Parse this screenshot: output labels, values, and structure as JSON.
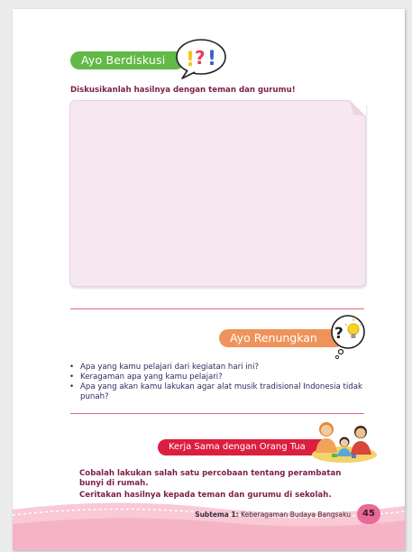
{
  "discussion": {
    "title": "Ayo Berdiskusi",
    "instruction": "Diskusikanlah hasilnya dengan teman dan gurumu!"
  },
  "reflection": {
    "title": "Ayo Renungkan",
    "items": [
      "Apa yang kamu pelajari dari kegiatan hari ini?",
      "Keragaman apa yang kamu pelajari?",
      "Apa yang akan kamu lakukan agar alat musik tradisional Indonesia tidak punah?"
    ]
  },
  "parents": {
    "title": "Kerja Sama dengan Orang Tua",
    "paragraphs": [
      "Cobalah lakukan salah satu percobaan tentang perambatan bunyi di rumah.",
      "Ceritakan hasilnya kepada teman dan gurumu di sekolah."
    ]
  },
  "footer": {
    "subtema_label": "Subtema 1:",
    "subtema_title": "Keberagaman Budaya Bangsaku",
    "page_number": "45"
  },
  "colors": {
    "green": "#62b947",
    "orange": "#f0935a",
    "red": "#dc1f3f",
    "maroon": "#7b1e49",
    "pink": "#e86a96",
    "box": "#f6e7f0"
  },
  "icons": {
    "discussion": "exclamation-question-bubble-icon",
    "reflection": "question-lightbulb-bubble-icon",
    "parents": "family-illustration"
  }
}
